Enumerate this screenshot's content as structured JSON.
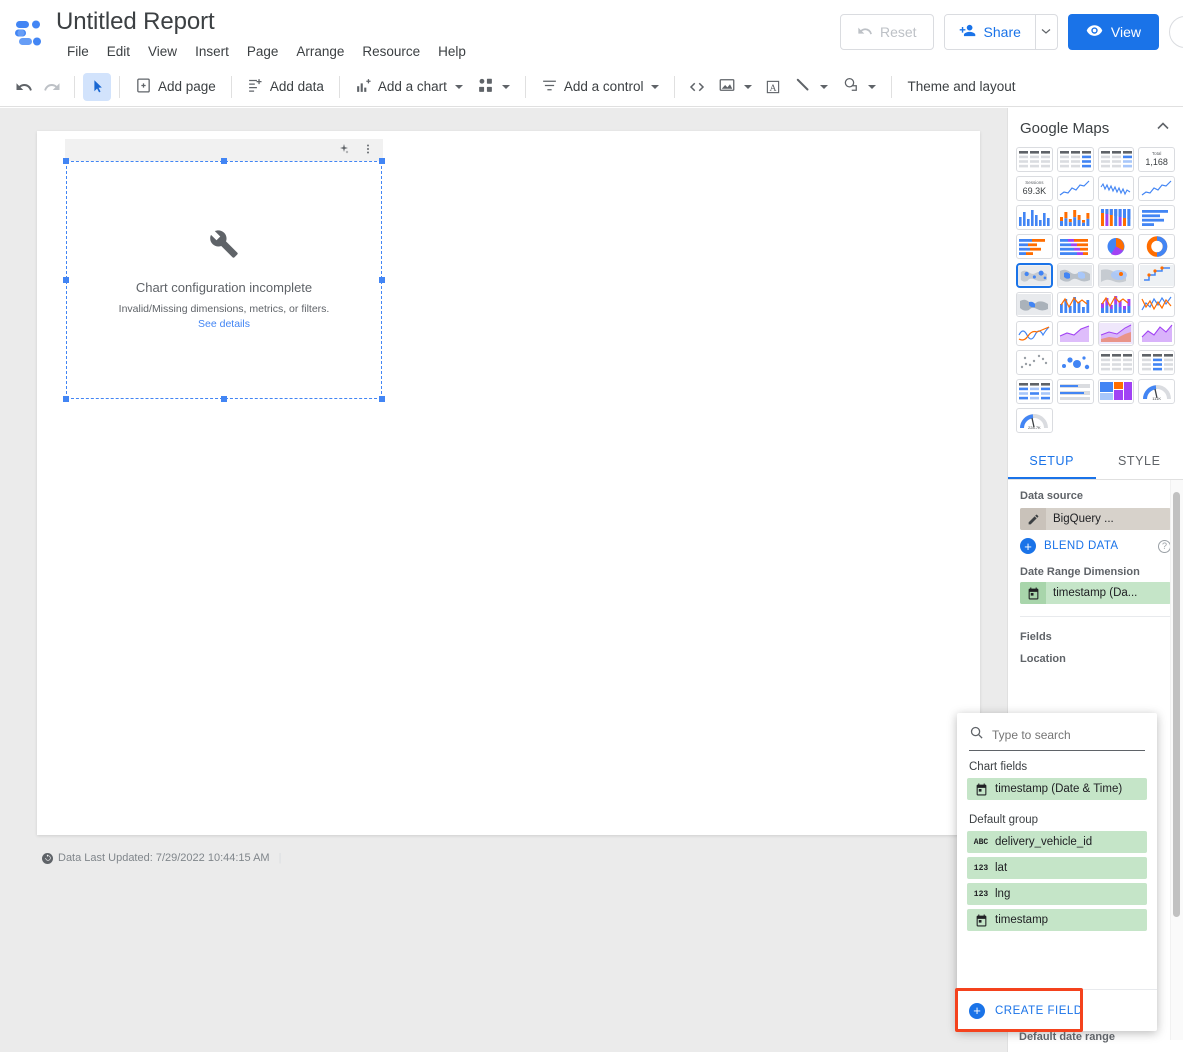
{
  "app": {
    "title": "Untitled Report",
    "logo_icon": "looker-studio-logo"
  },
  "menubar": {
    "items": [
      {
        "label": "File",
        "name": "menu-file"
      },
      {
        "label": "Edit",
        "name": "menu-edit"
      },
      {
        "label": "View",
        "name": "menu-view"
      },
      {
        "label": "Insert",
        "name": "menu-insert"
      },
      {
        "label": "Page",
        "name": "menu-page"
      },
      {
        "label": "Arrange",
        "name": "menu-arrange"
      },
      {
        "label": "Resource",
        "name": "menu-resource"
      },
      {
        "label": "Help",
        "name": "menu-help"
      }
    ]
  },
  "topright": {
    "reset_label": "Reset",
    "share_label": "Share",
    "view_label": "View",
    "reset_icon": "undo-icon",
    "share_icon": "person-add-icon",
    "view_icon": "eye-icon",
    "avatar_icon": "account-avatar"
  },
  "toolbar": {
    "undo_icon": "undo-icon",
    "redo_icon": "redo-icon",
    "select_icon": "cursor-arrow-icon",
    "add_page": "Add page",
    "add_data": "Add data",
    "add_chart": "Add a chart",
    "add_control": "Add a control",
    "community_viz_icon": "community-visualization-icon",
    "embed_icon": "embed-code-icon",
    "image_icon": "image-icon",
    "textbox_icon": "text-box-icon",
    "line_icon": "line-tool-icon",
    "shape_icon": "shape-tool-icon",
    "theme_layout": "Theme and layout"
  },
  "canvas": {
    "placeholder": {
      "title": "Chart configuration incomplete",
      "subtitle": "Invalid/Missing dimensions, metrics, or filters.",
      "link": "See details",
      "wrench_icon": "wrench-icon",
      "sparkle_icon": "sparkle-icon",
      "more_icon": "more-vert-icon"
    },
    "footnote": "Data Last Updated: 7/29/2022 10:44:15 AM",
    "footnote_icon": "refresh-icon"
  },
  "right_panel": {
    "header_title": "Google Maps",
    "collapse_icon": "chevron-up-icon",
    "gallery": [
      {
        "name": "table-chart",
        "kind": "table"
      },
      {
        "name": "table-with-bars-chart",
        "kind": "table-bars"
      },
      {
        "name": "table-with-heatmap-chart",
        "kind": "table-heat"
      },
      {
        "name": "scorecard-chart",
        "kind": "scorecard",
        "label": "Total",
        "value": "1,168"
      },
      {
        "name": "scorecard-compact-chart",
        "kind": "scorecard",
        "label": "Sessions",
        "value": "69.3K"
      },
      {
        "name": "time-series-chart",
        "kind": "line"
      },
      {
        "name": "sparkline-chart",
        "kind": "line-dense"
      },
      {
        "name": "smoothed-time-series-chart",
        "kind": "line"
      },
      {
        "name": "column-chart",
        "kind": "column"
      },
      {
        "name": "stacked-column-chart",
        "kind": "column-stack"
      },
      {
        "name": "100-stacked-column-chart",
        "kind": "column-full"
      },
      {
        "name": "bar-chart",
        "kind": "bar"
      },
      {
        "name": "stacked-bar-chart",
        "kind": "bar-stack"
      },
      {
        "name": "100-stacked-bar-chart",
        "kind": "bar-full"
      },
      {
        "name": "pie-chart",
        "kind": "pie"
      },
      {
        "name": "donut-chart",
        "kind": "donut"
      },
      {
        "name": "google-maps-bubble-map",
        "kind": "map-bubble",
        "selected": true
      },
      {
        "name": "google-maps-filled-map",
        "kind": "map-filled"
      },
      {
        "name": "google-maps-heatmap",
        "kind": "map-heat"
      },
      {
        "name": "treemap-chart",
        "kind": "treemap"
      },
      {
        "name": "geo-chart",
        "kind": "geo"
      },
      {
        "name": "combo-chart",
        "kind": "combo"
      },
      {
        "name": "stacked-combo-chart",
        "kind": "combo-stack"
      },
      {
        "name": "line-combo-chart",
        "kind": "line-combo"
      },
      {
        "name": "smoothed-line-chart",
        "kind": "smooth-line"
      },
      {
        "name": "area-chart",
        "kind": "area"
      },
      {
        "name": "stacked-area-chart",
        "kind": "area-stack"
      },
      {
        "name": "100-stacked-area-chart",
        "kind": "area-full"
      },
      {
        "name": "scatter-chart",
        "kind": "scatter"
      },
      {
        "name": "bubble-chart",
        "kind": "bubble"
      },
      {
        "name": "pivot-table-chart",
        "kind": "pivot"
      },
      {
        "name": "pivot-table-bars-chart",
        "kind": "pivot-bars"
      },
      {
        "name": "pivot-table-heatmap-chart",
        "kind": "pivot-heat"
      },
      {
        "name": "bullet-chart",
        "kind": "bullet"
      },
      {
        "name": "treemap-colored-chart",
        "kind": "treemap2"
      },
      {
        "name": "gauge-chart",
        "kind": "gauge",
        "value": "111K"
      },
      {
        "name": "gauge-large-chart",
        "kind": "gauge",
        "value": "228.7K"
      }
    ],
    "tabs": [
      {
        "label": "SETUP",
        "name": "tab-setup",
        "active": true
      },
      {
        "label": "STYLE",
        "name": "tab-style",
        "active": false
      }
    ],
    "setup": {
      "data_source_label": "Data source",
      "data_source_value": "BigQuery ...",
      "data_source_icon": "pencil-icon",
      "blend_data_label": "BLEND DATA",
      "blend_plus_icon": "plus-icon",
      "help_icon": "question-mark-icon",
      "date_range_dimension_label": "Date Range Dimension",
      "date_range_dimension_value": "timestamp (Da...",
      "date_range_icon": "calendar-icon",
      "fields_label": "Fields",
      "location_label": "Location",
      "default_date_range_label": "Default date range"
    }
  },
  "field_picker": {
    "search_placeholder": "Type to search",
    "search_value": "",
    "search_icon": "search-icon",
    "groups": [
      {
        "label": "Chart fields",
        "fields": [
          {
            "label": "timestamp (Date & Time)",
            "type_icon": "calendar-icon",
            "type": "date"
          }
        ]
      },
      {
        "label": "Default group",
        "fields": [
          {
            "label": "delivery_vehicle_id",
            "type_icon": "abc-icon",
            "type": "text"
          },
          {
            "label": "lat",
            "type_icon": "123-icon",
            "type": "number"
          },
          {
            "label": "lng",
            "type_icon": "123-icon",
            "type": "number"
          },
          {
            "label": "timestamp",
            "type_icon": "calendar-icon",
            "type": "date"
          }
        ]
      }
    ],
    "create_field_label": "CREATE FIELD",
    "create_field_icon": "plus-icon"
  },
  "colors": {
    "accent_blue": "#1a73e8",
    "highlight_red": "#f4421d",
    "chip_green": "#c5e5c8",
    "chip_gray": "#d7d2cb",
    "workspace_gray": "#ebebeb"
  }
}
